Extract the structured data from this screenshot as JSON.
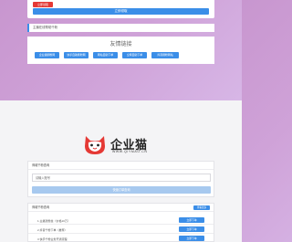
{
  "top_card": {
    "tag": "立即领取",
    "submit_label": "立即领取"
  },
  "notice": {
    "text": "主播在线帮助千粉"
  },
  "friend_links": {
    "title": "友情链接",
    "items": [
      {
        "label": "企业猫刷粉网"
      },
      {
        "label": "快手自助刷粉网"
      },
      {
        "label": "网站自助下单"
      },
      {
        "label": "全网自助下单"
      },
      {
        "label": "抖音刷粉网站"
      }
    ]
  },
  "brand": {
    "name": "企业猫",
    "url": "WWW.QIYMAO.CN"
  },
  "query_panel": {
    "title": "商城千粉查询",
    "input_placeholder": "请输入账号",
    "query_label": "快速订单查询"
  },
  "results_panel": {
    "title": "商城千粉查询",
    "head_button": "查看更多",
    "rows": [
      {
        "text": "1.主播涨粉丝（价格10万）",
        "action": "立即下单"
      },
      {
        "text": "2.抖音千粉下单（推荐）",
        "action": "立即下单"
      },
      {
        "text": "3.快手千粉业务开通流程",
        "action": "立即下单"
      }
    ]
  },
  "colors": {
    "accent": "#3b8ee8",
    "tag_red": "#e53935",
    "background_gradient_start": "#c896cf",
    "background_gradient_end": "#dcc3ef"
  }
}
